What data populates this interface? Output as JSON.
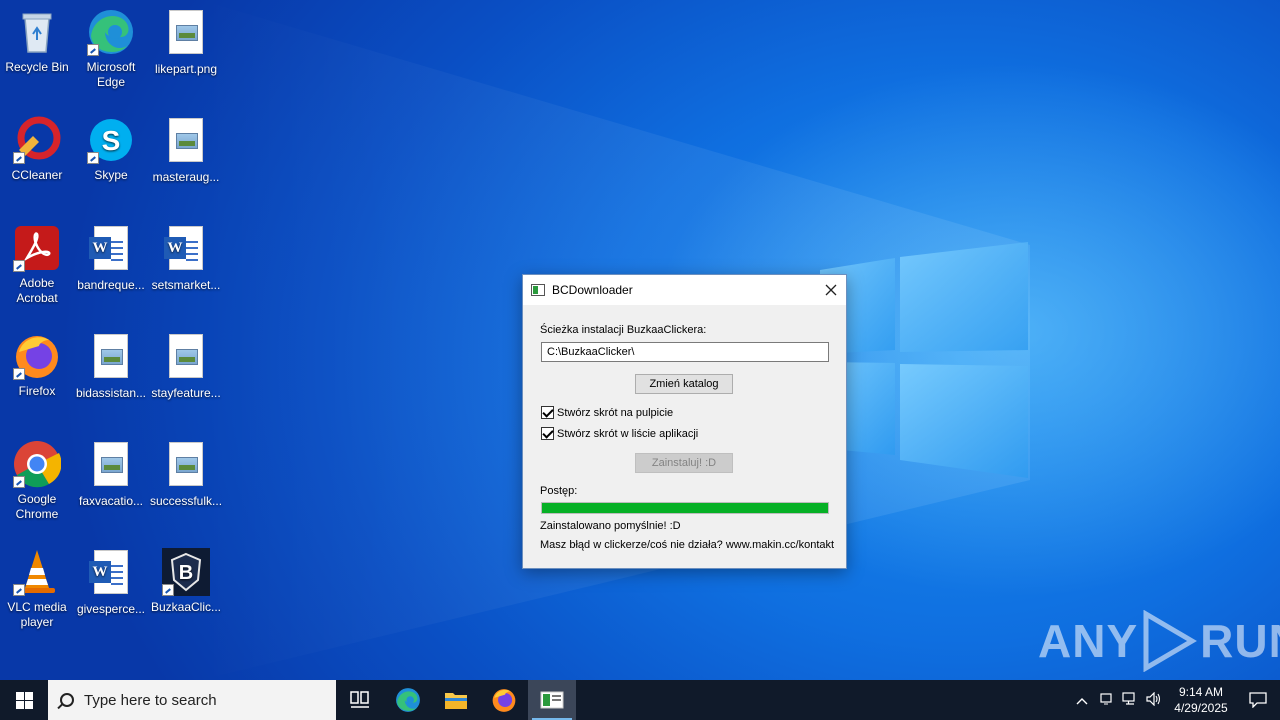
{
  "desktop": {
    "icons": [
      {
        "name": "recycle-bin",
        "label": "Recycle Bin"
      },
      {
        "name": "microsoft-edge",
        "label": "Microsoft Edge"
      },
      {
        "name": "likepart-png",
        "label": "likepart.png"
      },
      {
        "name": "ccleaner",
        "label": "CCleaner"
      },
      {
        "name": "skype",
        "label": "Skype"
      },
      {
        "name": "masteraug",
        "label": "masteraug..."
      },
      {
        "name": "adobe-acrobat",
        "label": "Adobe Acrobat"
      },
      {
        "name": "bandreque",
        "label": "bandreque..."
      },
      {
        "name": "setsmarket",
        "label": "setsmarket..."
      },
      {
        "name": "firefox",
        "label": "Firefox"
      },
      {
        "name": "bidassistan",
        "label": "bidassistan..."
      },
      {
        "name": "stayfeature",
        "label": "stayfeature..."
      },
      {
        "name": "google-chrome",
        "label": "Google Chrome"
      },
      {
        "name": "faxvacatio",
        "label": "faxvacatio..."
      },
      {
        "name": "successfulk",
        "label": "successfulk..."
      },
      {
        "name": "vlc-media-player",
        "label": "VLC media player"
      },
      {
        "name": "givesperce",
        "label": "givesperce..."
      },
      {
        "name": "buzkaaclic",
        "label": "BuzkaaClic..."
      }
    ]
  },
  "dialog": {
    "title": "BCDownloader",
    "path_label": "Ścieżka instalacji BuzkaaClickera:",
    "path_value": "C:\\BuzkaaClicker\\",
    "change_dir_button": "Zmień katalog",
    "checkbox_desktop": {
      "label": "Stwórz skrót na pulpicie",
      "checked": true
    },
    "checkbox_apps": {
      "label": "Stwórz skrót w liście aplikacji",
      "checked": true
    },
    "install_button": "Zainstaluj! :D",
    "progress_label": "Postęp:",
    "progress_value": 1.0,
    "status_text": "Zainstalowano pomyślnie! :D",
    "contact_text": "Masz błąd w clickerze/coś nie działa? www.makin.cc/kontakt",
    "accent_color": "#06b025"
  },
  "taskbar": {
    "search_placeholder": "Type here to search",
    "time": "9:14 AM",
    "date": "4/29/2025"
  },
  "watermark": {
    "text_left": "ANY",
    "text_right": "RUN"
  }
}
